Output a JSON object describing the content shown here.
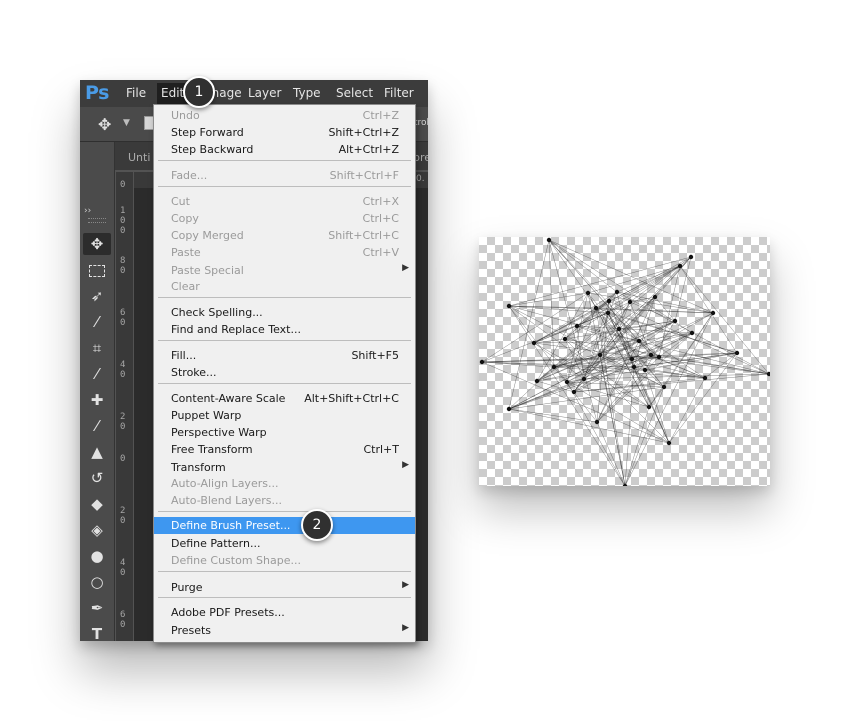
{
  "app": {
    "logo": "Ps"
  },
  "menubar": {
    "items": [
      {
        "label": "File"
      },
      {
        "label": "Edit"
      },
      {
        "label": "Image"
      },
      {
        "label": "Layer"
      },
      {
        "label": "Type"
      },
      {
        "label": "Select"
      },
      {
        "label": "Filter"
      }
    ]
  },
  "options_bar": {
    "partial_text": "trol"
  },
  "document": {
    "tab_label": "Unti",
    "tab_right_partial": "pre",
    "right_ruler_partial": "0."
  },
  "ruler_vertical": {
    "labels": [
      "0",
      "1",
      "0",
      "0",
      "8",
      "0",
      "6",
      "0",
      "4",
      "0",
      "2",
      "0",
      "0",
      "2",
      "0",
      "4",
      "0",
      "6",
      "0"
    ]
  },
  "tools": [
    {
      "icon": "move-icon"
    },
    {
      "icon": "marquee-icon"
    },
    {
      "icon": "lasso-icon"
    },
    {
      "icon": "magic-wand-icon"
    },
    {
      "icon": "crop-icon"
    },
    {
      "icon": "eyedropper-icon"
    },
    {
      "icon": "healing-brush-icon"
    },
    {
      "icon": "brush-icon"
    },
    {
      "icon": "clone-stamp-icon"
    },
    {
      "icon": "history-brush-icon"
    },
    {
      "icon": "eraser-icon"
    },
    {
      "icon": "paint-bucket-icon"
    },
    {
      "icon": "blur-icon"
    },
    {
      "icon": "dodge-icon"
    },
    {
      "icon": "pen-icon"
    },
    {
      "icon": "type-icon"
    },
    {
      "icon": "path-selection-icon"
    },
    {
      "icon": "rectangle-icon"
    }
  ],
  "edit_menu": {
    "items": [
      {
        "label": "Undo",
        "shortcut": "Ctrl+Z",
        "disabled": true
      },
      {
        "label": "Step Forward",
        "shortcut": "Shift+Ctrl+Z"
      },
      {
        "label": "Step Backward",
        "shortcut": "Alt+Ctrl+Z"
      },
      {
        "label": "Fade...",
        "shortcut": "Shift+Ctrl+F",
        "disabled": true
      },
      {
        "label": "Cut",
        "shortcut": "Ctrl+X",
        "disabled": true
      },
      {
        "label": "Copy",
        "shortcut": "Ctrl+C",
        "disabled": true
      },
      {
        "label": "Copy Merged",
        "shortcut": "Shift+Ctrl+C",
        "disabled": true
      },
      {
        "label": "Paste",
        "shortcut": "Ctrl+V",
        "disabled": true
      },
      {
        "label": "Paste Special",
        "disabled": true,
        "submenu": true
      },
      {
        "label": "Clear",
        "disabled": true
      },
      {
        "label": "Check Spelling..."
      },
      {
        "label": "Find and Replace Text..."
      },
      {
        "label": "Fill...",
        "shortcut": "Shift+F5"
      },
      {
        "label": "Stroke..."
      },
      {
        "label": "Content-Aware Scale",
        "shortcut": "Alt+Shift+Ctrl+C"
      },
      {
        "label": "Puppet Warp"
      },
      {
        "label": "Perspective Warp"
      },
      {
        "label": "Free Transform",
        "shortcut": "Ctrl+T"
      },
      {
        "label": "Transform",
        "submenu": true
      },
      {
        "label": "Auto-Align Layers...",
        "disabled": true
      },
      {
        "label": "Auto-Blend Layers...",
        "disabled": true
      },
      {
        "label": "Define Brush Preset...",
        "highlighted": true
      },
      {
        "label": "Define Pattern..."
      },
      {
        "label": "Define Custom Shape...",
        "disabled": true
      },
      {
        "label": "Purge",
        "submenu": true
      },
      {
        "label": "Adobe PDF Presets..."
      },
      {
        "label": "Presets",
        "submenu": true
      }
    ]
  },
  "callouts": [
    {
      "number": "1"
    },
    {
      "number": "2"
    }
  ],
  "colors": {
    "highlight": "#3e97f0",
    "ps_logo": "#4a9be6",
    "badge": "#303030"
  }
}
